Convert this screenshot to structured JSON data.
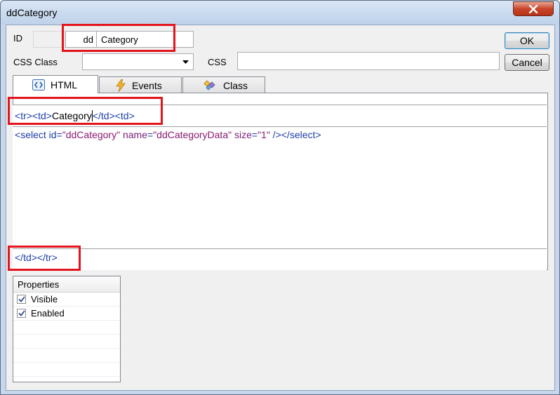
{
  "window": {
    "title": "ddCategory"
  },
  "id_row": {
    "label": "ID",
    "prefix": "dd",
    "value": "Category"
  },
  "css_row": {
    "css_class_label": "CSS Class",
    "css_class_value": "",
    "css_label": "CSS",
    "css_value": ""
  },
  "buttons": {
    "ok": "OK",
    "cancel": "Cancel"
  },
  "tabs": [
    {
      "label": "HTML",
      "icon": "html-icon"
    },
    {
      "label": "Events",
      "icon": "lightning-icon"
    },
    {
      "label": "Class",
      "icon": "class-icon"
    }
  ],
  "code": {
    "before": {
      "lt1": "<",
      "t1": "tr",
      "gt1": "><",
      "t2": "td",
      "gt2": ">",
      "text": "Category",
      "lt3": "</",
      "t3": "td",
      "gt3": "><",
      "t4": "td",
      "gt4": ">"
    },
    "main": {
      "lt": "<",
      "tag": "select",
      "sp1": " ",
      "a1": "id",
      "eq1": "=",
      "v1": "\"ddCategory\"",
      "sp2": " ",
      "a2": "name",
      "eq2": "=",
      "v2": "\"ddCategoryData\"",
      "sp3": " ",
      "a3": "size",
      "eq3": "=",
      "v3": "\"1\"",
      "close": " /></",
      "tag2": "select",
      "gt": ">"
    },
    "after": {
      "lt1": "</",
      "t1": "td",
      "mid": "></",
      "t2": "tr",
      "gt": ">"
    }
  },
  "properties": {
    "header": "Properties",
    "items": [
      {
        "label": "Visible",
        "checked": true
      },
      {
        "label": "Enabled",
        "checked": true
      }
    ]
  },
  "colors": {
    "highlight": "#e3141c",
    "tag": "#1d3fa8",
    "attribute": "#7a1f7a"
  }
}
